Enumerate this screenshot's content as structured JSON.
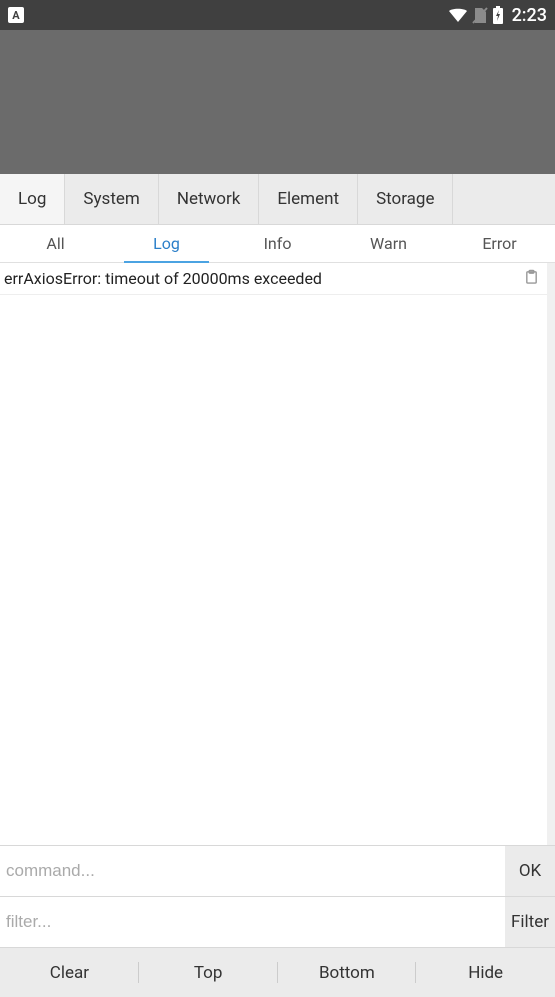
{
  "status_bar": {
    "app_letter": "A",
    "time": "2:23"
  },
  "main_tabs": {
    "items": [
      {
        "label": "Log"
      },
      {
        "label": "System"
      },
      {
        "label": "Network"
      },
      {
        "label": "Element"
      },
      {
        "label": "Storage"
      }
    ],
    "active_index": 0
  },
  "sub_tabs": {
    "items": [
      {
        "label": "All"
      },
      {
        "label": "Log"
      },
      {
        "label": "Info"
      },
      {
        "label": "Warn"
      },
      {
        "label": "Error"
      }
    ],
    "active_index": 1
  },
  "log_entries": [
    {
      "text": "errAxiosError: timeout of 20000ms exceeded"
    }
  ],
  "command_input": {
    "placeholder": "command...",
    "value": "",
    "button": "OK"
  },
  "filter_input": {
    "placeholder": "filter...",
    "value": "",
    "button": "Filter"
  },
  "bottom_bar": {
    "items": [
      {
        "label": "Clear"
      },
      {
        "label": "Top"
      },
      {
        "label": "Bottom"
      },
      {
        "label": "Hide"
      }
    ]
  }
}
